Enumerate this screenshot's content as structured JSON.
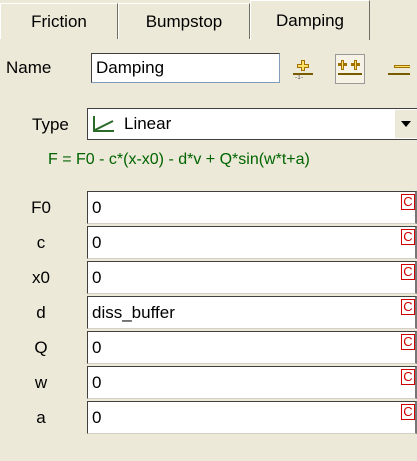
{
  "tabs": [
    {
      "label": "Friction"
    },
    {
      "label": "Bumpstop"
    },
    {
      "label": "Damping"
    }
  ],
  "name": {
    "label": "Name",
    "value": "Damping"
  },
  "type": {
    "label": "Type",
    "value": "Linear"
  },
  "formula": "F = F0 - c*(x-x0) - d*v + Q*sin(w*t+a)",
  "params": [
    {
      "label": "F0",
      "value": "0",
      "mark": "C"
    },
    {
      "label": "c",
      "value": "0",
      "mark": "C"
    },
    {
      "label": "x0",
      "value": "0",
      "mark": "C"
    },
    {
      "label": "d",
      "value": "diss_buffer",
      "mark": "C"
    },
    {
      "label": "Q",
      "value": "0",
      "mark": "C"
    },
    {
      "label": "w",
      "value": "0",
      "mark": "C"
    },
    {
      "label": "a",
      "value": "0",
      "mark": "C"
    }
  ],
  "colors": {
    "formula": "#006400",
    "mark": "#d00000",
    "background": "#ece9d8"
  },
  "icons": [
    "add-item-icon",
    "copy-item-icon",
    "remove-item-icon",
    "linear-graph-icon",
    "dropdown-arrow-icon"
  ]
}
